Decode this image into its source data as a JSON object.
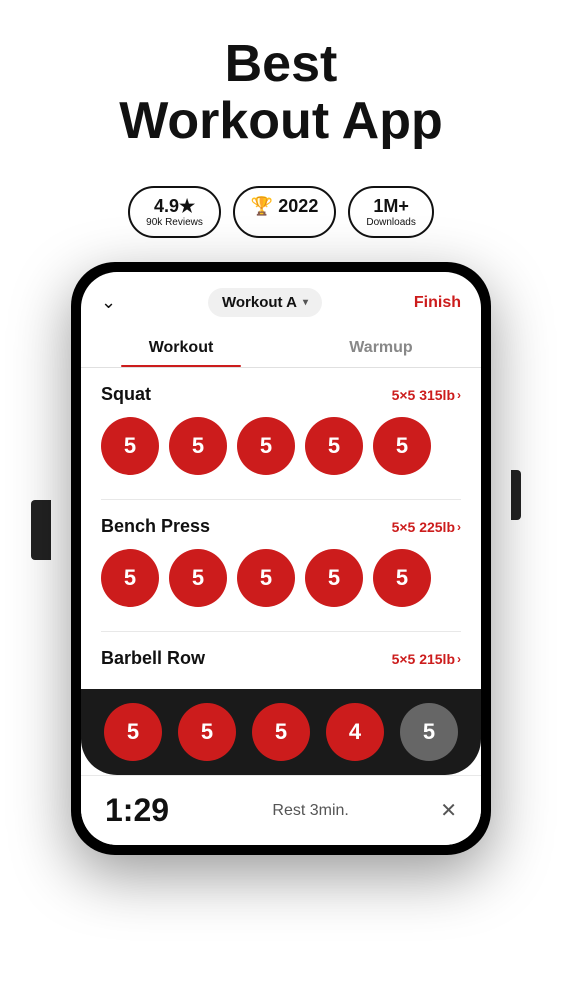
{
  "header": {
    "title": "Best",
    "title2": "Workout App"
  },
  "badges": [
    {
      "id": "rating",
      "main": "4.9★",
      "sub": "90k Reviews"
    },
    {
      "id": "award",
      "main": "🏆 2022",
      "sub": ""
    },
    {
      "id": "downloads",
      "main": "1M+",
      "sub": "Downloads"
    }
  ],
  "app": {
    "chevron": "∨",
    "workout_selector": "Workout A",
    "finish_label": "Finish",
    "tabs": [
      {
        "id": "workout",
        "label": "Workout",
        "active": true
      },
      {
        "id": "warmup",
        "label": "Warmup",
        "active": false
      }
    ],
    "exercises": [
      {
        "id": "squat",
        "name": "Squat",
        "sets_info": "5×5 315lb",
        "reps": [
          5,
          5,
          5,
          5,
          5
        ]
      },
      {
        "id": "bench-press",
        "name": "Bench Press",
        "sets_info": "5×5 225lb",
        "reps": [
          5,
          5,
          5,
          5,
          5
        ]
      },
      {
        "id": "barbell-row",
        "name": "Barbell Row",
        "sets_info": "5×5 215lb",
        "reps": [
          5,
          5,
          5,
          4,
          null
        ]
      }
    ],
    "bottom_reps": [
      5,
      5,
      5,
      4,
      null
    ],
    "rest_timer": {
      "time": "1:29",
      "label": "Rest 3min."
    }
  }
}
